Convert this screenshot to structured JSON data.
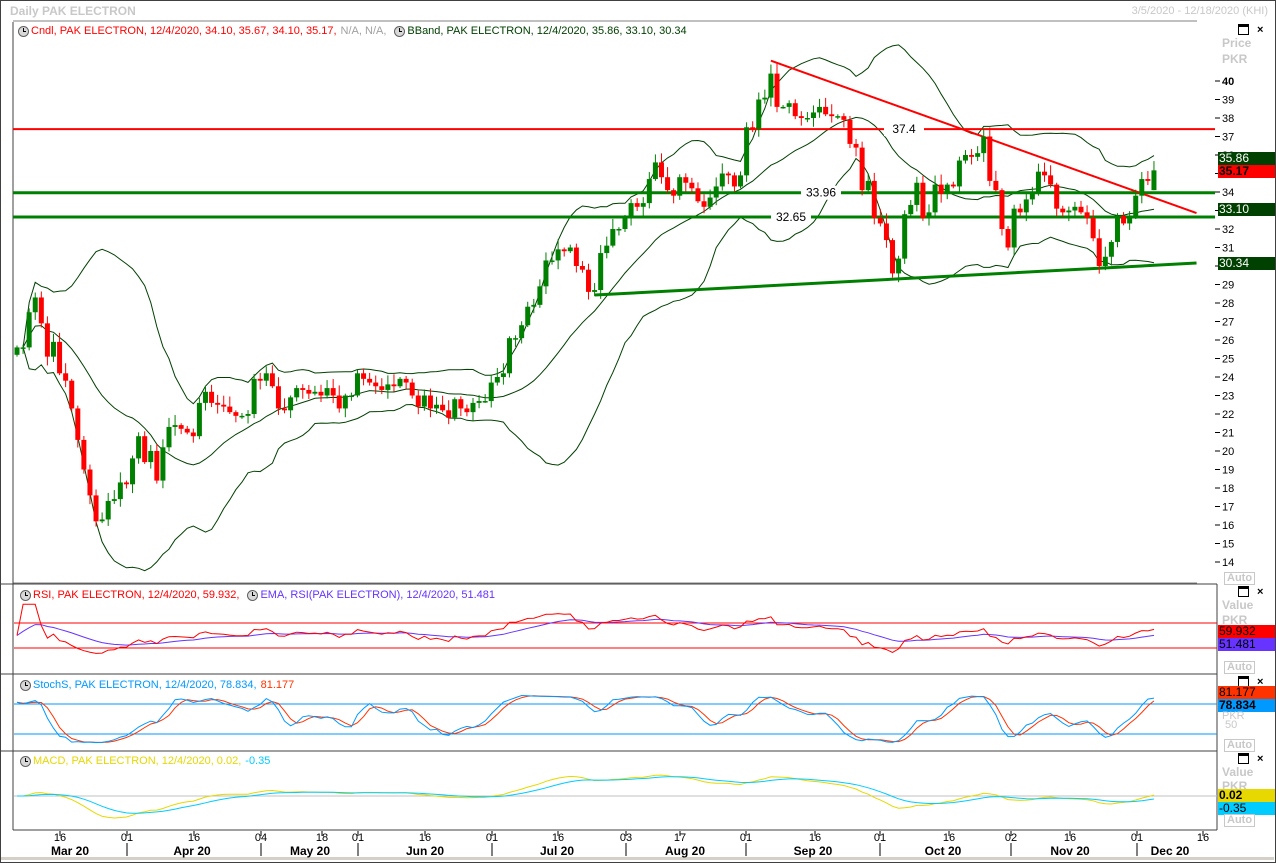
{
  "window": {
    "title": "Daily PAK ELECTRON",
    "date_range": "3/5/2020 - 12/18/2020 (KHI)"
  },
  "price_panel": {
    "legend": {
      "cndl": "Cndl, PAK ELECTRON, 12/4/2020, 34.10, 35.67, 34.10, 35.17,",
      "cndl_na": "N/A, N/A,",
      "bband": "BBand, PAK ELECTRON, 12/4/2020, 35.86, 33.10, 30.34"
    },
    "axis_title": "Price",
    "axis_unit": "PKR",
    "auto": "Auto",
    "value_boxes": [
      {
        "text": "35.86",
        "value": 35.86,
        "bg": "#004000",
        "fg": "#ffffff"
      },
      {
        "text": "35.17",
        "value": 35.17,
        "bg": "#ff0000",
        "fg": "#000000"
      },
      {
        "text": "33.10",
        "value": 33.1,
        "bg": "#004000",
        "fg": "#ffffff"
      },
      {
        "text": "30.34",
        "value": 30.34,
        "bg": "#004000",
        "fg": "#ffffff"
      }
    ],
    "hline_labels": [
      "37.4",
      "33.96",
      "32.65"
    ]
  },
  "rsi_panel": {
    "legend_rsi": "RSI, PAK ELECTRON, 12/4/2020, 59.932,",
    "legend_ema": "EMA, RSI(PAK ELECTRON), 12/4/2020, 51.481",
    "axis_title": "Value",
    "axis_unit": "PKR",
    "auto": "Auto",
    "box_rsi": "59.932",
    "box_ema": "51.481"
  },
  "stoch_panel": {
    "legend_k": "StochS, PAK ELECTRON, 12/4/2020, 78.834,",
    "legend_d": "81.177",
    "axis_unit": "PKR",
    "axis_mid": "50",
    "auto": "Auto",
    "box_d": "81.177",
    "box_k": "78.834"
  },
  "macd_panel": {
    "legend_macd": "MACD, PAK ELECTRON, 12/4/2020, 0.02,",
    "legend_signal": "-0.35",
    "axis_title": "Value",
    "axis_unit": "PKR",
    "auto": "Auto",
    "box_macd": "0.02",
    "box_signal": "-0.35"
  },
  "date_axis": {
    "day_ticks": [
      "16",
      "01",
      "16",
      "04",
      "18",
      "01",
      "16",
      "01",
      "16",
      "03",
      "17",
      "01",
      "16",
      "01",
      "16",
      "02",
      "16",
      "01",
      "16"
    ],
    "months": [
      "Mar 20",
      "Apr 20",
      "May 20",
      "Jun 20",
      "Jul 20",
      "Aug 20",
      "Sep 20",
      "Oct 20",
      "Nov 20",
      "Dec 20"
    ]
  },
  "colors": {
    "up": "#008000",
    "down": "#ff0000",
    "bband": "#004000",
    "rsi": "#ff0000",
    "rsi_ema": "#6633ff",
    "stoch_k": "#0099ff",
    "stoch_d": "#ff3300",
    "macd": "#e6d800",
    "signal": "#00ccff"
  },
  "chart_data": [
    {
      "type": "candlestick",
      "title": "Daily PAK ELECTRON",
      "ylabel": "Price PKR",
      "ylim": [
        13,
        43
      ],
      "yticks": [
        14,
        15,
        16,
        17,
        18,
        19,
        20,
        21,
        22,
        23,
        24,
        25,
        26,
        27,
        28,
        29,
        30,
        31,
        32,
        33,
        34,
        35,
        36,
        37,
        38,
        39,
        40
      ],
      "close": [
        25.6,
        25.6,
        27.5,
        28.3,
        26.9,
        25.1,
        25.9,
        24.2,
        23.8,
        22.3,
        20.6,
        19.0,
        17.6,
        16.2,
        16.3,
        17.3,
        17.4,
        18.3,
        18.2,
        19.6,
        20.8,
        19.4,
        20.0,
        18.4,
        20.2,
        21.3,
        21.4,
        21.2,
        21.0,
        20.8,
        22.6,
        23.2,
        22.6,
        22.5,
        22.4,
        22.1,
        21.9,
        21.9,
        22.0,
        23.9,
        23.8,
        24.2,
        23.5,
        22.3,
        22.2,
        22.9,
        23.4,
        23.3,
        23.1,
        23.2,
        23.0,
        23.4,
        23.0,
        22.3,
        23.0,
        23.0,
        24.2,
        23.9,
        23.7,
        23.5,
        23.3,
        23.6,
        23.5,
        23.9,
        23.7,
        23.0,
        22.4,
        23.0,
        22.3,
        22.5,
        22.2,
        21.8,
        22.8,
        22.3,
        22.1,
        22.6,
        22.7,
        22.7,
        23.7,
        24.0,
        24.2,
        26.1,
        26.1,
        26.8,
        27.8,
        27.9,
        28.9,
        30.3,
        30.3,
        30.9,
        30.8,
        31.0,
        30.0,
        29.8,
        28.6,
        28.7,
        30.7,
        31.1,
        32.0,
        32.0,
        32.6,
        33.4,
        33.2,
        33.4,
        34.7,
        35.6,
        34.8,
        34.1,
        33.8,
        34.8,
        34.5,
        34.2,
        33.5,
        33.2,
        33.7,
        34.3,
        35.0,
        34.9,
        34.3,
        34.9,
        37.5,
        37.4,
        39.0,
        39.1,
        40.4,
        38.6,
        38.6,
        38.8,
        38.1,
        38.0,
        38.0,
        38.3,
        38.6,
        38.2,
        38.1,
        38.1,
        37.9,
        36.6,
        36.4,
        34.1,
        34.6,
        32.6,
        32.3,
        31.4,
        29.6,
        30.4,
        32.8,
        33.3,
        34.5,
        32.6,
        32.9,
        34.4,
        33.9,
        34.4,
        34.3,
        35.7,
        36.0,
        35.9,
        36.1,
        37.0,
        34.6,
        34.1,
        32.0,
        31.0,
        33.1,
        32.9,
        33.6,
        33.9,
        35.1,
        34.9,
        34.4,
        33.1,
        32.9,
        33.0,
        33.2,
        32.9,
        32.6,
        31.5,
        30.0,
        30.5,
        31.3,
        32.7,
        32.3,
        32.7,
        33.8,
        34.7,
        34.6,
        35.17
      ],
      "last_bar": {
        "date": "12/4/2020",
        "open": 34.1,
        "high": 35.67,
        "low": 34.1,
        "close": 35.17
      },
      "bollinger": {
        "upper": 35.86,
        "middle": 33.1,
        "lower": 30.34
      },
      "horizontal_lines": [
        {
          "value": 37.4,
          "color": "red"
        },
        {
          "value": 33.96,
          "color": "green"
        },
        {
          "value": 32.65,
          "color": "green"
        }
      ],
      "trendlines": [
        {
          "color": "red",
          "from": {
            "bar": 124,
            "price": 41.1
          },
          "to": {
            "bar": 194,
            "price": 32.86
          }
        },
        {
          "color": "green",
          "from": {
            "bar": 95,
            "price": 28.43
          },
          "to": {
            "bar": 194,
            "price": 30.16
          }
        }
      ]
    },
    {
      "type": "line",
      "title": "RSI",
      "levels": [
        70,
        30
      ],
      "last": {
        "rsi": 59.932,
        "ema": 51.481
      }
    },
    {
      "type": "line",
      "title": "StochS",
      "levels": [
        80,
        20
      ],
      "last": {
        "k": 78.834,
        "d": 81.177
      }
    },
    {
      "type": "line",
      "title": "MACD",
      "last": {
        "macd": 0.02,
        "signal": -0.35
      }
    }
  ]
}
